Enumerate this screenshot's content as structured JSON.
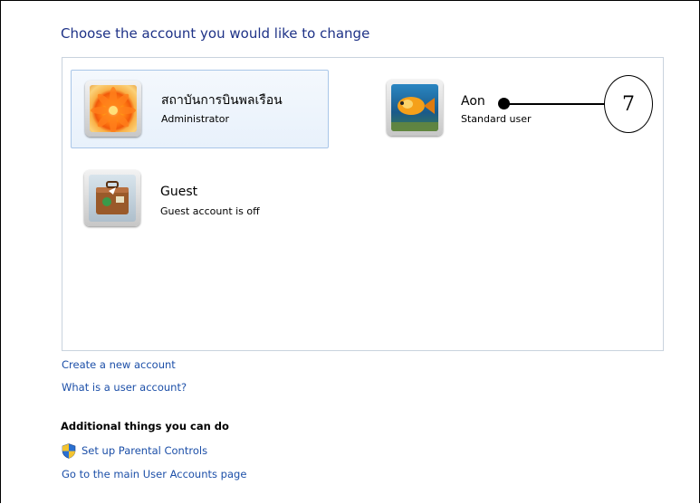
{
  "heading": "Choose the account you would like to change",
  "accounts": [
    {
      "name": "สถาบันการบินพลเรือน",
      "type": "Administrator",
      "picture": "orange-flower-icon"
    },
    {
      "name": "Aon",
      "type": "Standard user",
      "picture": "tropical-fish-icon"
    },
    {
      "name": "Guest",
      "type": "Guest account is off",
      "picture": "suitcase-icon"
    }
  ],
  "links": {
    "create_account": "Create a new account",
    "what_is_account": "What is a user account?"
  },
  "additional": {
    "title": "Additional things you can do",
    "parental_controls": "Set up Parental Controls",
    "main_page": "Go to the main User Accounts page"
  },
  "callout": {
    "number": "7"
  }
}
